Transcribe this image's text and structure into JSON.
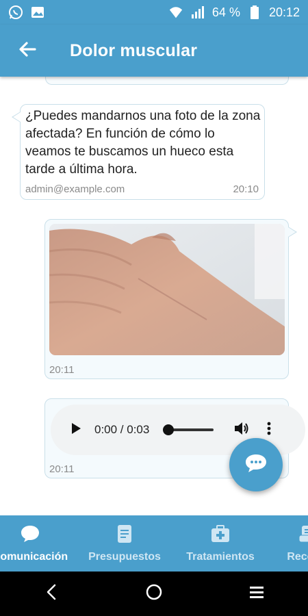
{
  "status_bar": {
    "battery_percent": "64 %",
    "time": "20:12",
    "icons": [
      "whatsapp-icon",
      "image-icon",
      "wifi-icon",
      "signal-icon",
      "battery-icon"
    ]
  },
  "app_bar": {
    "title": "Dolor muscular",
    "back_icon": "arrow-left-icon"
  },
  "messages": [
    {
      "direction": "incoming",
      "type": "text",
      "text": "¿Puedes mandarnos una foto de la zona afectada? En función de cómo lo veamos te buscamos un hueco esta tarde a última hora.",
      "sender": "admin@example.com",
      "time": "20:10"
    },
    {
      "direction": "outgoing",
      "type": "image",
      "time": "20:11"
    },
    {
      "direction": "outgoing",
      "type": "audio",
      "audio_time": "0:00 / 0:03",
      "time": "20:11"
    }
  ],
  "fab": {
    "icon": "chat-bubble-icon"
  },
  "bottom_nav": {
    "items": [
      {
        "label": "Comunicación",
        "icon": "chat-icon",
        "active": true
      },
      {
        "label": "Presupuestos",
        "icon": "document-icon",
        "active": false
      },
      {
        "label": "Tratamientos",
        "icon": "first-aid-kit-icon",
        "active": false
      },
      {
        "label": "Recetas",
        "icon": "prescription-icon",
        "active": false
      }
    ]
  },
  "system_nav": [
    "back-icon",
    "home-icon",
    "recents-icon"
  ],
  "colors": {
    "primary": "#4a9fcc",
    "bubble_border": "#c9dfe9",
    "nav_inactive_text": "#cfe6f3"
  }
}
